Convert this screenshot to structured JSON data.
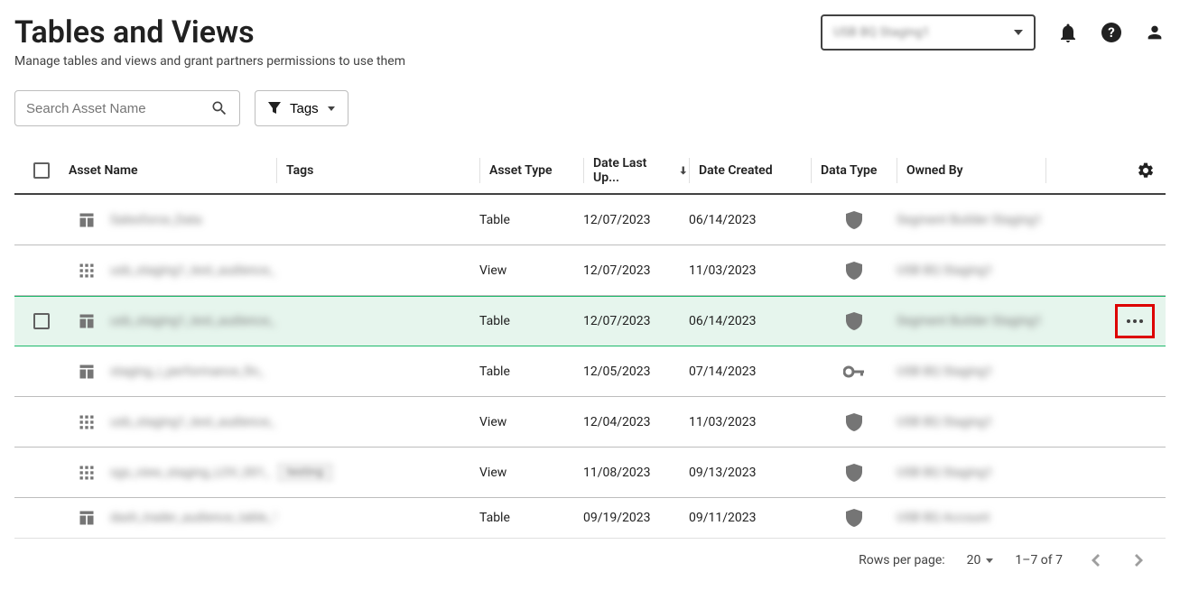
{
  "header": {
    "title": "Tables and Views",
    "subtitle": "Manage tables and views and grant partners permissions to use them",
    "dataset_selector": "USB BQ Staging1"
  },
  "controls": {
    "search_placeholder": "Search Asset Name",
    "tags_button": "Tags"
  },
  "columns": {
    "asset": "Asset Name",
    "tags": "Tags",
    "type": "Asset Type",
    "updated": "Date Last Up...",
    "created": "Date Created",
    "datatype": "Data Type",
    "owned": "Owned By"
  },
  "rows": [
    {
      "name": "Salesforce_Data",
      "tags": "",
      "type": "Table",
      "updated": "12/07/2023",
      "created": "06/14/2023",
      "icon": "shield",
      "owned": "Segment Builder Staging1",
      "row_icon": "table",
      "selected": false
    },
    {
      "name": "usb_staging1_test_audience_",
      "tags": "",
      "type": "View",
      "updated": "12/07/2023",
      "created": "11/03/2023",
      "icon": "shield",
      "owned": "USB BQ Staging1",
      "row_icon": "view",
      "selected": false
    },
    {
      "name": "usb_staging1_test_audience_",
      "tags": "",
      "type": "Table",
      "updated": "12/07/2023",
      "created": "06/14/2023",
      "icon": "shield",
      "owned": "Segment Builder Staging1",
      "row_icon": "table",
      "selected": true
    },
    {
      "name": "staging_i_performance_fin_",
      "tags": "",
      "type": "Table",
      "updated": "12/05/2023",
      "created": "07/14/2023",
      "icon": "key",
      "owned": "USB BQ Staging1",
      "row_icon": "table",
      "selected": false
    },
    {
      "name": "usb_staging1_test_audience_",
      "tags": "",
      "type": "View",
      "updated": "12/04/2023",
      "created": "11/03/2023",
      "icon": "shield",
      "owned": "USB BQ Staging1",
      "row_icon": "view",
      "selected": false
    },
    {
      "name": "sgs_view_staging_LOV_001_",
      "tags": "testing",
      "type": "View",
      "updated": "11/08/2023",
      "created": "09/13/2023",
      "icon": "shield",
      "owned": "USB BQ Staging1",
      "row_icon": "view",
      "selected": false
    },
    {
      "name": "dash_trader_audience_table_1",
      "tags": "",
      "type": "Table",
      "updated": "09/19/2023",
      "created": "09/11/2023",
      "icon": "shield",
      "owned": "USB BQ Account",
      "row_icon": "table",
      "selected": false,
      "last": true
    }
  ],
  "pagination": {
    "rows_label": "Rows per page:",
    "page_size": "20",
    "range": "1–7 of 7"
  }
}
